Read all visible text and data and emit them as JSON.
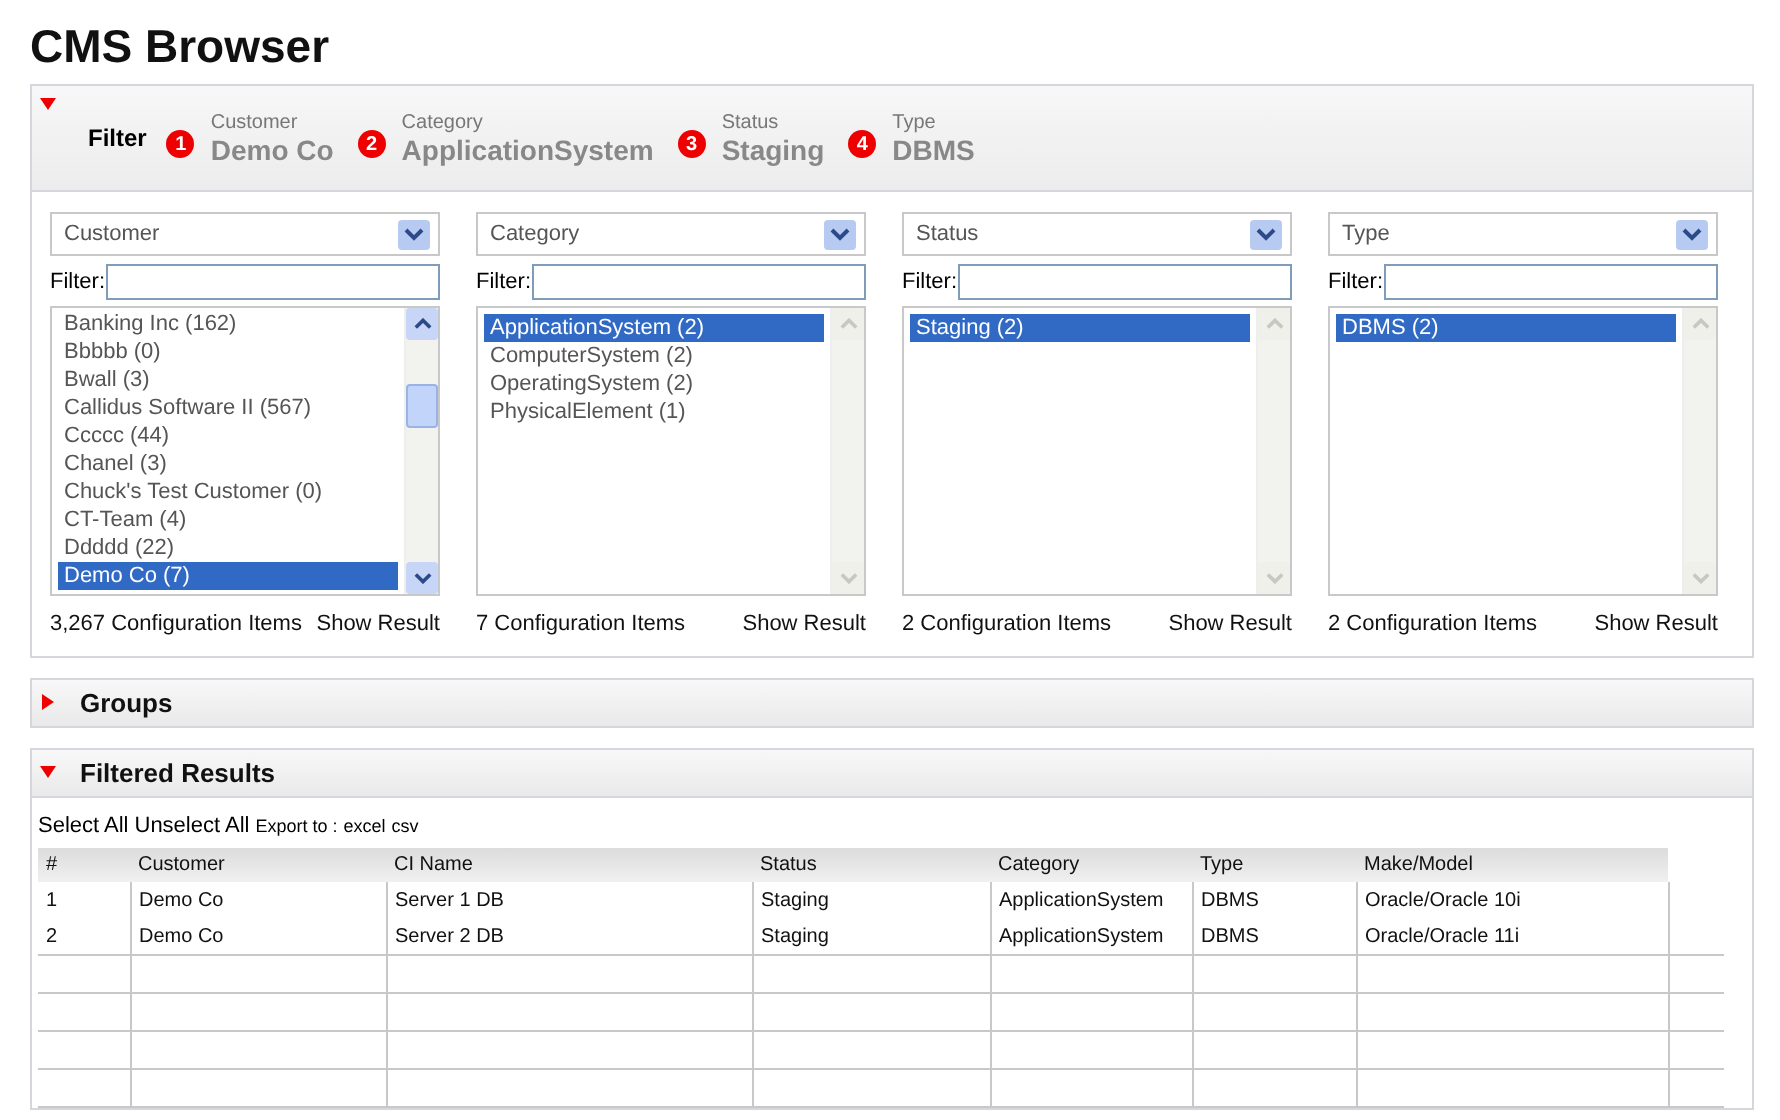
{
  "page_title": "CMS Browser",
  "filter": {
    "expanded": true,
    "label": "Filter",
    "chips": [
      {
        "number": "1",
        "label": "Customer",
        "value": "Demo Co"
      },
      {
        "number": "2",
        "label": "Category",
        "value": "ApplicationSystem"
      },
      {
        "number": "3",
        "label": "Status",
        "value": "Staging"
      },
      {
        "number": "4",
        "label": "Type",
        "value": "DBMS"
      }
    ],
    "columns": [
      {
        "dropdown": "Customer",
        "filter_label": "Filter:",
        "scrollable": true,
        "items": [
          {
            "label": "Banking Inc (162)",
            "selected": false
          },
          {
            "label": "Bbbbb (0)",
            "selected": false
          },
          {
            "label": "Bwall (3)",
            "selected": false
          },
          {
            "label": "Callidus Software II (567)",
            "selected": false
          },
          {
            "label": "Ccccc (44)",
            "selected": false
          },
          {
            "label": "Chanel (3)",
            "selected": false
          },
          {
            "label": "Chuck's Test Customer (0)",
            "selected": false
          },
          {
            "label": "CT-Team (4)",
            "selected": false
          },
          {
            "label": "Ddddd (22)",
            "selected": false
          },
          {
            "label": "Demo Co (7)",
            "selected": true
          }
        ],
        "count": "3,267 Configuration Items",
        "action": "Show Result"
      },
      {
        "dropdown": "Category",
        "filter_label": "Filter:",
        "scrollable": false,
        "items": [
          {
            "label": "ApplicationSystem (2)",
            "selected": true
          },
          {
            "label": "ComputerSystem (2)",
            "selected": false
          },
          {
            "label": "OperatingSystem (2)",
            "selected": false
          },
          {
            "label": "PhysicalElement (1)",
            "selected": false
          }
        ],
        "count": "7 Configuration Items",
        "action": "Show Result"
      },
      {
        "dropdown": "Status",
        "filter_label": "Filter:",
        "scrollable": false,
        "items": [
          {
            "label": "Staging (2)",
            "selected": true
          }
        ],
        "count": "2 Configuration Items",
        "action": "Show Result"
      },
      {
        "dropdown": "Type",
        "filter_label": "Filter:",
        "scrollable": false,
        "items": [
          {
            "label": "DBMS (2)",
            "selected": true
          }
        ],
        "count": "2 Configuration Items",
        "action": "Show Result"
      }
    ]
  },
  "groups": {
    "title": "Groups",
    "expanded": false
  },
  "results": {
    "title": "Filtered Results",
    "expanded": true,
    "toolbar": {
      "select_all": "Select All",
      "unselect_all": "Unselect All",
      "export_label": "Export to :",
      "export_links": [
        "excel",
        "csv"
      ]
    },
    "table": {
      "columns": [
        "#",
        "Customer",
        "CI Name",
        "Status",
        "Category",
        "Type",
        "Make/Model"
      ],
      "rows": [
        [
          "1",
          "Demo Co",
          "Server 1 DB",
          "Staging",
          "ApplicationSystem",
          "DBMS",
          "Oracle/Oracle 10i"
        ],
        [
          "2",
          "Demo Co",
          "Server 2 DB",
          "Staging",
          "ApplicationSystem",
          "DBMS",
          "Oracle/Oracle 11i"
        ]
      ]
    }
  }
}
